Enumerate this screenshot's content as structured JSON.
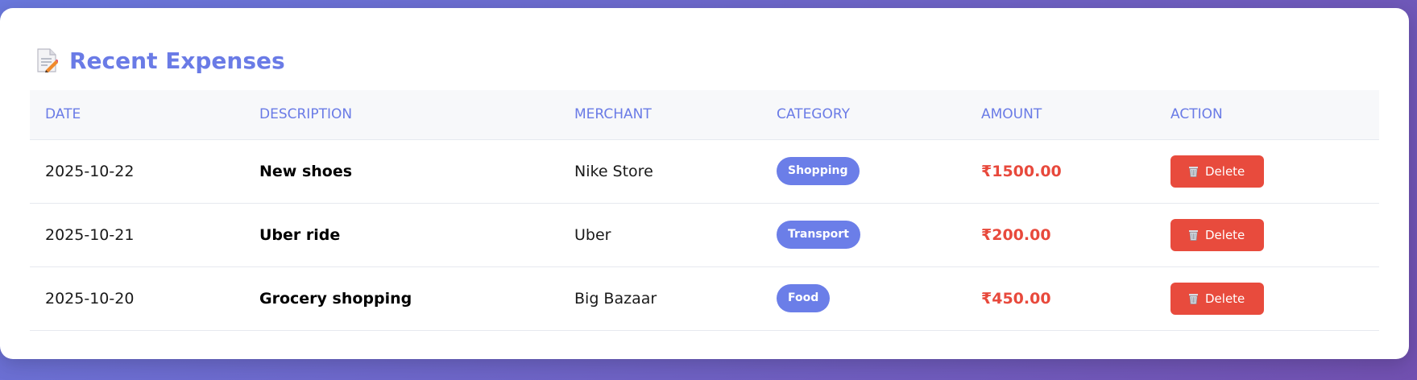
{
  "header": {
    "icon": "memo-icon",
    "title": "Recent Expenses"
  },
  "table": {
    "columns": [
      "DATE",
      "DESCRIPTION",
      "MERCHANT",
      "CATEGORY",
      "AMOUNT",
      "ACTION"
    ],
    "rows": [
      {
        "date": "2025-10-22",
        "description": "New shoes",
        "merchant": "Nike Store",
        "category": "Shopping",
        "amount": "₹1500.00",
        "action": "Delete"
      },
      {
        "date": "2025-10-21",
        "description": "Uber ride",
        "merchant": "Uber",
        "category": "Transport",
        "amount": "₹200.00",
        "action": "Delete"
      },
      {
        "date": "2025-10-20",
        "description": "Grocery shopping",
        "merchant": "Big Bazaar",
        "category": "Food",
        "amount": "₹450.00",
        "action": "Delete"
      }
    ]
  },
  "colors": {
    "accent": "#6a7be6",
    "amount": "#e8493c",
    "delete_button": "#e84b3d",
    "badge": "#6b7ee8"
  }
}
